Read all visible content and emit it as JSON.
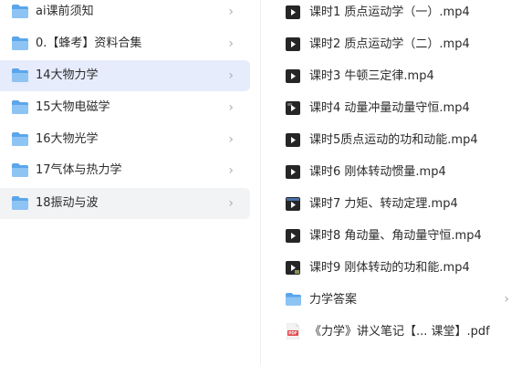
{
  "left_list": {
    "items": [
      {
        "label": "ai课前须知",
        "icon": "folder-icon",
        "state": "normal"
      },
      {
        "label": "0.【蜂考】资料合集",
        "icon": "folder-icon",
        "state": "normal"
      },
      {
        "label": "14大物力学",
        "icon": "folder-icon",
        "state": "selected"
      },
      {
        "label": "15大物电磁学",
        "icon": "folder-icon",
        "state": "normal"
      },
      {
        "label": "16大物光学",
        "icon": "folder-icon",
        "state": "normal"
      },
      {
        "label": "17气体与热力学",
        "icon": "folder-icon",
        "state": "normal"
      },
      {
        "label": "18振动与波",
        "icon": "folder-icon",
        "state": "hovered"
      }
    ],
    "chevron": "›"
  },
  "right_list": {
    "items": [
      {
        "label": "课时1 质点运动学（一）.mp4",
        "icon": "video-icon"
      },
      {
        "label": "课时2 质点运动学（二）.mp4",
        "icon": "video-icon"
      },
      {
        "label": "课时3 牛顿三定律.mp4",
        "icon": "video-icon"
      },
      {
        "label": "课时4 动量冲量动量守恒.mp4",
        "icon": "video-icon"
      },
      {
        "label": "课时5质点运动的功和动能.mp4",
        "icon": "video-icon"
      },
      {
        "label": "课时6 刚体转动惯量.mp4",
        "icon": "video-icon"
      },
      {
        "label": "课时7 力矩、转动定理.mp4",
        "icon": "video-icon"
      },
      {
        "label": "课时8 角动量、角动量守恒.mp4",
        "icon": "video-icon"
      },
      {
        "label": "课时9 刚体转动的功和能.mp4",
        "icon": "video-icon"
      },
      {
        "label": "力学答案",
        "icon": "folder-icon",
        "has_chevron": true
      },
      {
        "label": "《力学》讲义笔记【...  课堂】.pdf",
        "icon": "pdf-icon",
        "badge": "PDF"
      }
    ],
    "chevron": "›"
  },
  "colors": {
    "folder": "#5ba6ea",
    "folder_tab": "#8ec4f4",
    "selected_bg": "#e6ecfc",
    "hover_bg": "#f2f3f5",
    "video_icon": "#262626",
    "pdf_icon": "#e3484b"
  }
}
